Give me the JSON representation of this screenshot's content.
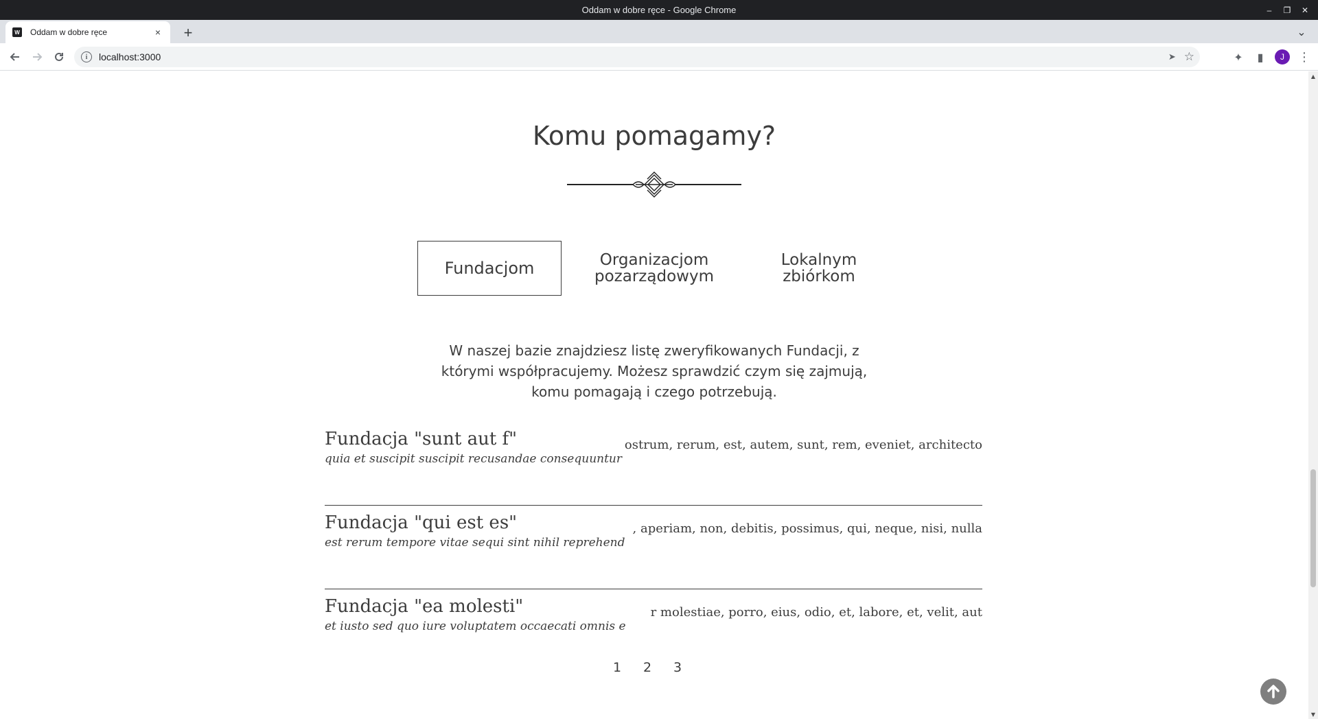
{
  "window": {
    "title": "Oddam w dobre ręce - Google Chrome",
    "controls": {
      "minimize": "–",
      "restore": "❐",
      "close": "✕"
    }
  },
  "browser": {
    "tab": {
      "favicon_text": "W",
      "title": "Oddam w dobre ręce",
      "close": "×"
    },
    "new_tab": "+",
    "tab_search": "⌄",
    "nav": {
      "back": "←",
      "forward": "→",
      "reload": "↻"
    },
    "address": "localhost:3000",
    "info": "i",
    "icons": {
      "send": "➤",
      "star": "☆",
      "extensions": "✦",
      "sidepanel": "▮",
      "menu": "⋮"
    },
    "profile_initial": "J"
  },
  "page": {
    "section_title": "Komu pomagamy?",
    "tabs": [
      {
        "label": "Fundacjom",
        "active": true
      },
      {
        "label": "Organizacjom pozarządowym",
        "active": false
      },
      {
        "label": "Lokalnym zbiórkom",
        "active": false
      }
    ],
    "description": "W naszej bazie znajdziesz listę zweryfikowanych Fundacji, z którymi współpracujemy. Możesz sprawdzić czym się zajmują, komu pomagają i czego potrzebują.",
    "items": [
      {
        "name": "Fundacja \"sunt aut f\"",
        "mission": "quia et suscipit suscipit recusandae consequuntur",
        "needs": "ostrum, rerum, est, autem, sunt, rem, eveniet, architecto"
      },
      {
        "name": "Fundacja \"qui est es\"",
        "mission": "est rerum tempore vitae sequi sint nihil reprehend",
        "needs": ", aperiam, non, debitis, possimus, qui, neque, nisi, nulla"
      },
      {
        "name": "Fundacja \"ea molesti\"",
        "mission": "et iusto sed quo iure voluptatem occaecati omnis e",
        "needs": "r molestiae, porro, eius, odio, et, labore, et, velit, aut"
      }
    ],
    "pagination": [
      "1",
      "2",
      "3"
    ],
    "scroll_top_icon": "arrow-up-circle-icon"
  }
}
